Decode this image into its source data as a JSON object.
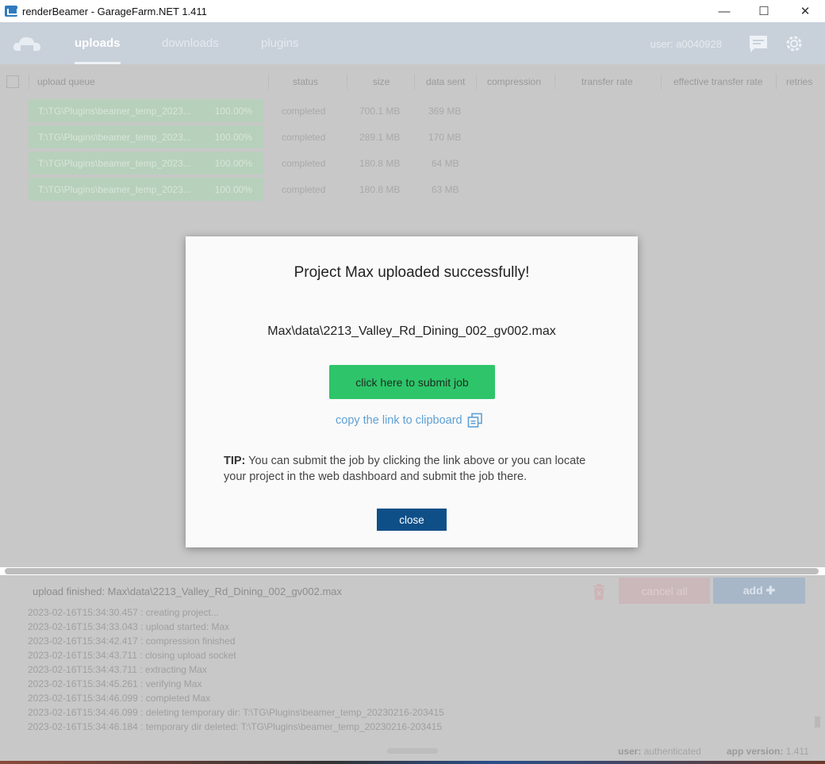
{
  "window": {
    "title": "renderBeamer - GarageFarm.NET 1.411",
    "minimize": "—",
    "maximize": "☐",
    "close": "✕"
  },
  "header": {
    "tabs": [
      "uploads",
      "downloads",
      "plugins"
    ],
    "active_tab": "uploads",
    "user": "user: a0040928"
  },
  "columns": [
    "upload queue",
    "status",
    "size",
    "data sent",
    "compression",
    "transfer rate",
    "effective transfer rate",
    "retries"
  ],
  "queue": [
    {
      "file": "T:\\TG\\Plugins\\beamer_temp_2023...",
      "progress": "100.00%",
      "status": "completed",
      "size": "700.1 MB",
      "sent": "369 MB"
    },
    {
      "file": "T:\\TG\\Plugins\\beamer_temp_2023...",
      "progress": "100.00%",
      "status": "completed",
      "size": "289.1 MB",
      "sent": "170 MB"
    },
    {
      "file": "T:\\TG\\Plugins\\beamer_temp_2023...",
      "progress": "100.00%",
      "status": "completed",
      "size": "180.8 MB",
      "sent": "64 MB"
    },
    {
      "file": "T:\\TG\\Plugins\\beamer_temp_2023...",
      "progress": "100.00%",
      "status": "completed",
      "size": "180.8 MB",
      "sent": "63 MB"
    }
  ],
  "statusbar": {
    "message": "upload finished: Max\\data\\2213_Valley_Rd_Dining_002_gv002.max",
    "cancel_all": "cancel all",
    "add": "add ✚"
  },
  "log": [
    "2023-02-16T15:34:30.457 : creating project...",
    "2023-02-16T15:34:33.043 : upload started: Max",
    "2023-02-16T15:34:42.417 : compression finished",
    "2023-02-16T15:34:43.711 : closing upload socket",
    "2023-02-16T15:34:43.711 : extracting Max",
    "2023-02-16T15:34:45.261 : verifying Max",
    "2023-02-16T15:34:46.099 : completed Max",
    "2023-02-16T15:34:46.099 : deleting temporary dir: T:\\TG\\Plugins\\beamer_temp_20230216-203415",
    "2023-02-16T15:34:46.184 : temporary dir deleted: T:\\TG\\Plugins\\beamer_temp_20230216-203415"
  ],
  "footer": {
    "user_label": "user:",
    "user_value": "authenticated",
    "version_label": "app version:",
    "version_value": "1.411"
  },
  "modal": {
    "title": "Project Max uploaded successfully!",
    "path": "Max\\data\\2213_Valley_Rd_Dining_002_gv002.max",
    "submit": "click here to submit job",
    "copy_link": "copy the link to clipboard",
    "tip_label": "TIP:",
    "tip_text": "You can submit the job by clicking the link above or you can locate your project in the web dashboard and submit the job there.",
    "close": "close"
  },
  "colors": {
    "submit_green": "#2ec56a",
    "close_blue": "#0f4f88",
    "link_blue": "#5fa0d4",
    "progress_green": "#b7d0bb"
  }
}
